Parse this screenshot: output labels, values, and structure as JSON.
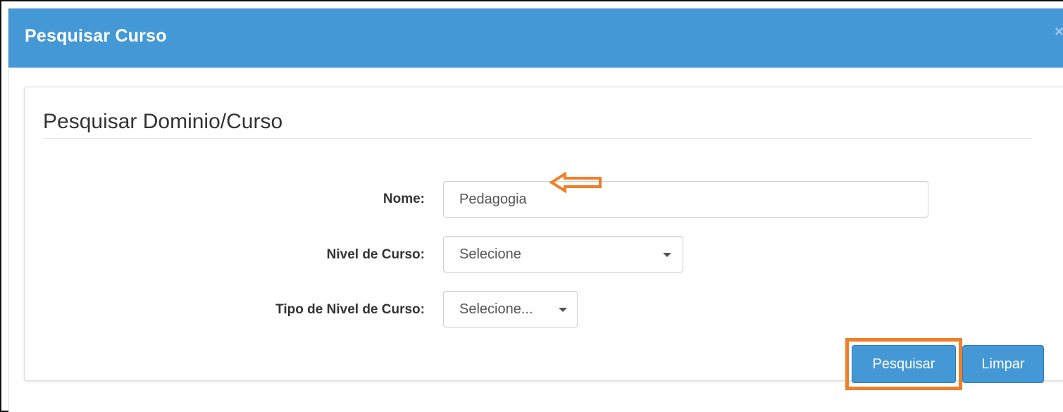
{
  "modal": {
    "title": "Pesquisar Curso",
    "close_glyph": "×"
  },
  "panel": {
    "title": "Pesquisar Dominio/Curso"
  },
  "form": {
    "nome": {
      "label": "Nome:",
      "value": "Pedagogia"
    },
    "nivel": {
      "label": "Nivel de Curso:",
      "selected": "Selecione"
    },
    "tipo_nivel": {
      "label": "Tipo de Nivel de Curso:",
      "selected": "Selecione..."
    }
  },
  "actions": {
    "search_label": "Pesquisar",
    "clear_label": "Limpar"
  },
  "colors": {
    "header": "#4598d6",
    "button": "#4598d6",
    "annotation": "#f07f2a"
  },
  "icons": {
    "close": "close-icon",
    "caret": "chevron-down-icon",
    "annotation_arrow": "arrow-left-icon"
  }
}
